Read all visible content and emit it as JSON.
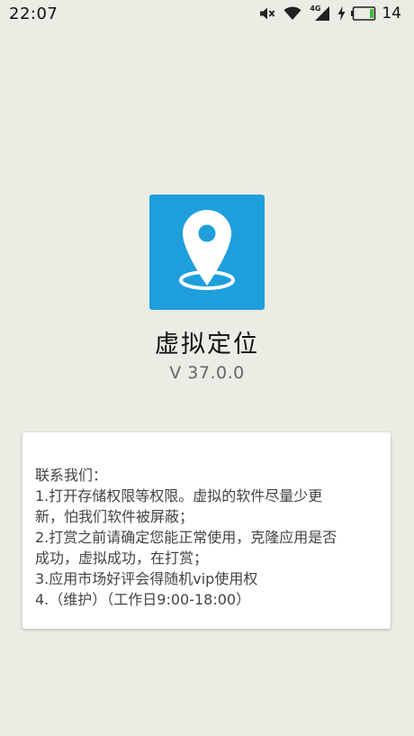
{
  "status_bar": {
    "time": "22:07",
    "network": "4G",
    "battery_level": "14",
    "icons": [
      "mute-icon",
      "wifi-icon",
      "signal-4g-icon",
      "charging-icon",
      "battery-icon"
    ]
  },
  "app": {
    "icon": "location-pin-icon",
    "name": "虚拟定位",
    "version": "V 37.0.0",
    "accent_color": "#1e9fdc"
  },
  "notice": {
    "lines": [
      "联系我们：",
      "1.打开存储权限等权限。虚拟的软件尽量少更",
      "新，怕我们软件被屏蔽；",
      "2.打赏之前请确定您能正常使用，克隆应用是否",
      "成功，虚拟成功，在打赏；",
      "3.应用市场好评会得随机vip使用权",
      "4.（维护）（工作日9:00-18:00）"
    ]
  }
}
